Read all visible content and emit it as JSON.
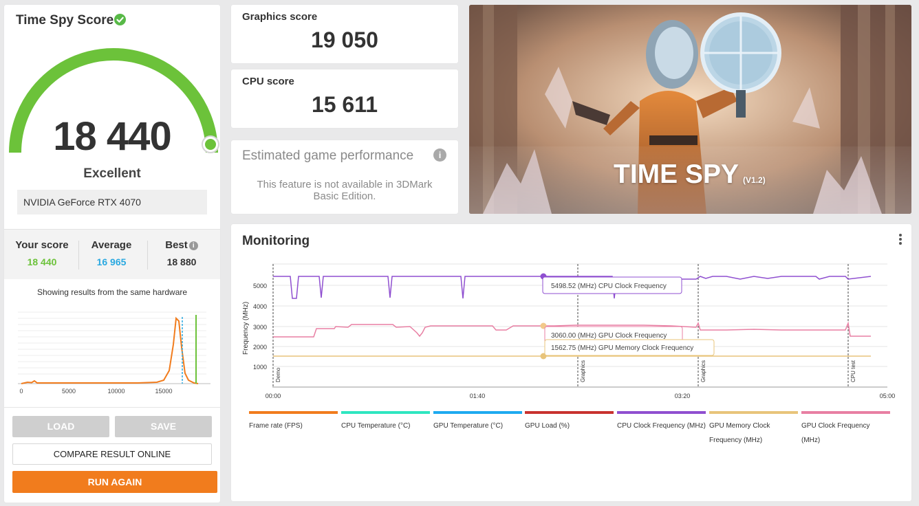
{
  "left": {
    "title": "Time Spy Score",
    "score": "18 440",
    "rating": "Excellent",
    "gpu": "NVIDIA GeForce RTX 4070",
    "gauge_fraction": 1.0,
    "compare": {
      "your_label": "Your score",
      "your_value": "18 440",
      "avg_label": "Average",
      "avg_value": "16 965",
      "best_label": "Best",
      "best_value": "18 880",
      "info_glyph": "i"
    },
    "hist_caption": "Showing results from the same hardware",
    "hist_ticks": [
      "0",
      "5000",
      "10000",
      "15000"
    ],
    "buttons": {
      "load": "LOAD",
      "save": "SAVE",
      "compare": "COMPARE RESULT ONLINE",
      "run": "RUN AGAIN"
    }
  },
  "graphics": {
    "label": "Graphics score",
    "value": "19 050"
  },
  "cpu": {
    "label": "CPU score",
    "value": "15 611"
  },
  "estimated": {
    "title": "Estimated game performance",
    "info_glyph": "i",
    "message": "This feature is not available in 3DMark Basic Edition."
  },
  "hero": {
    "title": "TIME SPY",
    "version": "(V1.2)"
  },
  "monitoring": {
    "title": "Monitoring",
    "ylabel": "Frequency (MHz)",
    "y_ticks": [
      "1000",
      "2000",
      "3000",
      "4000",
      "5000"
    ],
    "x_ticks": [
      "00:00",
      "01:40",
      "03:20",
      "05:00"
    ],
    "markers": [
      "Demo",
      "Graphics",
      "Graphics",
      "CPU test"
    ],
    "tooltips": [
      "5498.52 (MHz) CPU Clock Frequency",
      "3060.00 (MHz) GPU Clock Frequency",
      "1562.75 (MHz) GPU Memory Clock Frequency"
    ],
    "legend": [
      {
        "label": "Frame rate (FPS)",
        "color": "#f17c1d"
      },
      {
        "label": "CPU Temperature (°C)",
        "color": "#2ee6c0"
      },
      {
        "label": "GPU Temperature (°C)",
        "color": "#1eaaf0"
      },
      {
        "label": "GPU Load (%)",
        "color": "#c8322e"
      },
      {
        "label": "CPU Clock Frequency (MHz)",
        "color": "#8f4fd0"
      },
      {
        "label": "GPU Memory Clock Frequency (MHz)",
        "color": "#e8c47a"
      },
      {
        "label": "GPU Clock Frequency (MHz)",
        "color": "#e87fa3"
      }
    ]
  },
  "colors": {
    "accent_green": "#6cc23a",
    "accent_orange": "#f17c1d",
    "avg_blue": "#29a8e0"
  }
}
